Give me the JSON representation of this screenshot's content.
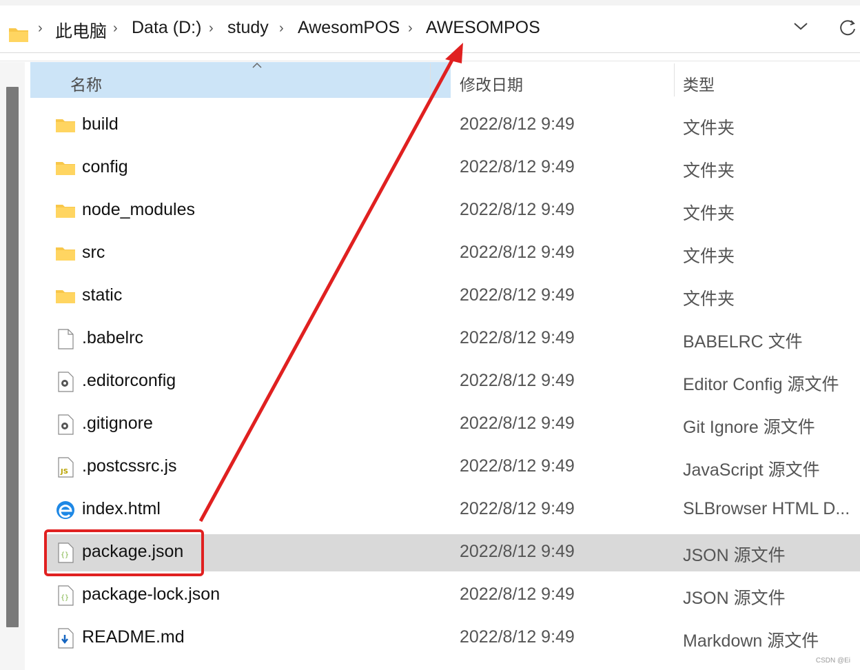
{
  "breadcrumb": {
    "items": [
      "此电脑",
      "Data (D:)",
      "study",
      "AwesomPOS",
      "AWESOMPOS"
    ],
    "separator": "›"
  },
  "columns": {
    "name": "名称",
    "modified": "修改日期",
    "type": "类型"
  },
  "files": [
    {
      "name": "build",
      "date": "2022/8/12 9:49",
      "type": "文件夹",
      "icon": "folder-icon"
    },
    {
      "name": "config",
      "date": "2022/8/12 9:49",
      "type": "文件夹",
      "icon": "folder-icon"
    },
    {
      "name": "node_modules",
      "date": "2022/8/12 9:49",
      "type": "文件夹",
      "icon": "folder-icon"
    },
    {
      "name": "src",
      "date": "2022/8/12 9:49",
      "type": "文件夹",
      "icon": "folder-icon"
    },
    {
      "name": "static",
      "date": "2022/8/12 9:49",
      "type": "文件夹",
      "icon": "folder-icon"
    },
    {
      "name": ".babelrc",
      "date": "2022/8/12 9:49",
      "type": "BABELRC 文件",
      "icon": "blank-file-icon"
    },
    {
      "name": ".editorconfig",
      "date": "2022/8/12 9:49",
      "type": "Editor Config 源文件",
      "icon": "gear-file-icon"
    },
    {
      "name": ".gitignore",
      "date": "2022/8/12 9:49",
      "type": "Git Ignore 源文件",
      "icon": "gear-file-icon"
    },
    {
      "name": ".postcssrc.js",
      "date": "2022/8/12 9:49",
      "type": "JavaScript 源文件",
      "icon": "js-file-icon"
    },
    {
      "name": "index.html",
      "date": "2022/8/12 9:49",
      "type": "SLBrowser HTML D...",
      "icon": "browser-icon"
    },
    {
      "name": "package.json",
      "date": "2022/8/12 9:49",
      "type": "JSON 源文件",
      "icon": "json-file-icon",
      "selected": true
    },
    {
      "name": "package-lock.json",
      "date": "2022/8/12 9:49",
      "type": "JSON 源文件",
      "icon": "json-file-icon"
    },
    {
      "name": "README.md",
      "date": "2022/8/12 9:49",
      "type": "Markdown 源文件",
      "icon": "markdown-file-icon"
    }
  ],
  "colors": {
    "selection": "#d9d9d9",
    "header_highlight": "#cce4f7",
    "annotation_red": "#e02020",
    "folder_yellow": "#f8c74a"
  },
  "watermark": "CSDN @Ei"
}
